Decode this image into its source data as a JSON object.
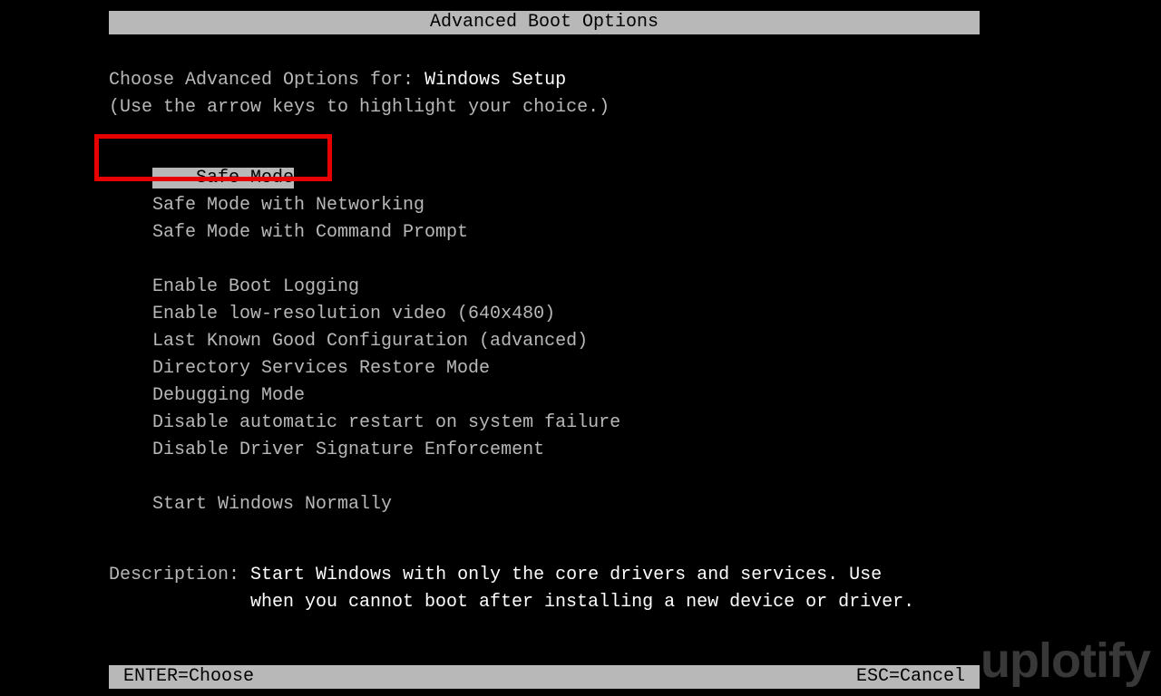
{
  "title": "Advanced Boot Options",
  "prompt": {
    "prefix": "Choose Advanced Options for: ",
    "target": "Windows Setup",
    "hint": "(Use the arrow keys to highlight your choice.)"
  },
  "options": {
    "group1": [
      "Safe Mode",
      "Safe Mode with Networking",
      "Safe Mode with Command Prompt"
    ],
    "group2": [
      "Enable Boot Logging",
      "Enable low-resolution video (640x480)",
      "Last Known Good Configuration (advanced)",
      "Directory Services Restore Mode",
      "Debugging Mode",
      "Disable automatic restart on system failure",
      "Disable Driver Signature Enforcement"
    ],
    "group3": [
      "Start Windows Normally"
    ],
    "selected_index": 0
  },
  "description": {
    "label": "Description: ",
    "line1": "Start Windows with only the core drivers and services. Use",
    "line2": "when you cannot boot after installing a new device or driver."
  },
  "footer": {
    "enter": "ENTER=Choose",
    "esc": "ESC=Cancel"
  },
  "watermark": "uplotify"
}
